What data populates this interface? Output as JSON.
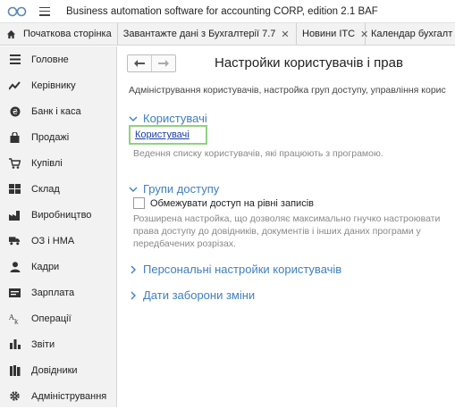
{
  "app": {
    "title": "Business automation software for accounting CORP, edition 2.1 BAF"
  },
  "tabs": [
    {
      "label": "Початкова сторінка",
      "icon": "home-icon",
      "closable": false
    },
    {
      "label": "Завантажте дані з Бухгалтерії 7.7",
      "closable": true
    },
    {
      "label": "Новини ІТС",
      "closable": true
    },
    {
      "label": "Календар бухгалт",
      "closable": false
    }
  ],
  "sidebar": {
    "items": [
      {
        "label": "Головне",
        "icon": "menu-lines-icon"
      },
      {
        "label": "Керівнику",
        "icon": "trend-icon"
      },
      {
        "label": "Банк і каса",
        "icon": "coin-icon"
      },
      {
        "label": "Продажі",
        "icon": "bag-icon"
      },
      {
        "label": "Купівлі",
        "icon": "cart-icon"
      },
      {
        "label": "Склад",
        "icon": "warehouse-icon"
      },
      {
        "label": "Виробництво",
        "icon": "factory-icon"
      },
      {
        "label": "ОЗ і НМА",
        "icon": "truck-icon"
      },
      {
        "label": "Кадри",
        "icon": "person-icon"
      },
      {
        "label": "Зарплата",
        "icon": "payroll-icon"
      },
      {
        "label": "Операції",
        "icon": "operations-icon"
      },
      {
        "label": "Звіти",
        "icon": "bar-chart-icon"
      },
      {
        "label": "Довідники",
        "icon": "books-icon"
      },
      {
        "label": "Адміністрування",
        "icon": "gear-icon"
      }
    ]
  },
  "main": {
    "title": "Настройки користувачів і прав",
    "description": "Адміністрування користувачів, настройка груп доступу, управління корис",
    "sections": {
      "users": {
        "label": "Користувачі",
        "link": "Користувачі",
        "hint": "Ведення списку користувачів, які працюють з програмою."
      },
      "access_groups": {
        "label": "Групи доступу",
        "checkbox_label": "Обмежувати доступ на рівні записів",
        "checkbox_checked": false,
        "hint_lines": [
          "Розширена настройка, що дозволяє максимально гнучко настроювати",
          "права доступу до довідників, документів і інших даних програми у",
          "передбачених розрізах."
        ]
      },
      "personal": {
        "label": "Персональні настройки користувачів"
      },
      "change_ban": {
        "label": "Дати заборони зміни"
      }
    }
  },
  "colors": {
    "section_title": "#3f7fbf",
    "link": "#1a3da6",
    "highlight_border": "#8fd37a",
    "sidebar_bg": "#f2f2f2"
  }
}
